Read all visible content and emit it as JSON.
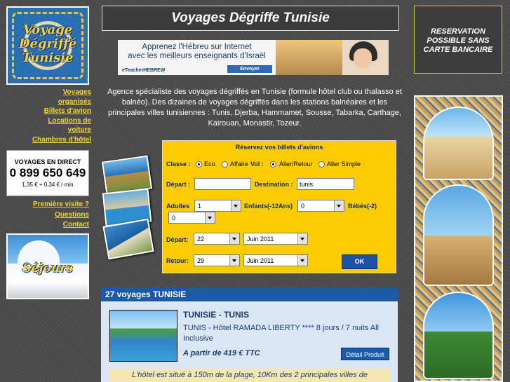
{
  "header": {
    "title": "Voyages Dégriffe Tunisie"
  },
  "logo": {
    "line1": "Voyage",
    "line2": "Dégriffé",
    "line3": "Tunisie"
  },
  "reservation": {
    "text": "RESERVATION POSSIBLE SANS CARTE BANCAIRE"
  },
  "ad": {
    "line1": "Apprenez l'Hébreu sur Internet",
    "line2": "avec les meilleurs enseignants d'Israël",
    "brand": "eTeacherHEBREW",
    "button": "Envoyer"
  },
  "sidebar": {
    "links1": [
      "Voyages organisés",
      "Billets d'avion",
      "Locations de voiture",
      "Chambres d'hôtel"
    ],
    "phone": {
      "label": "VOYAGES EN DIRECT",
      "number": "0 899 650 649",
      "price": "1,35 € + 0,34 € / min"
    },
    "links2": [
      "Première visite ?",
      "Questions",
      "Contact"
    ],
    "sejours": "Séjours"
  },
  "intro": "Agence spécialiste des voyages dégriffés en Tunisie (formule hôtel club ou thalasso et balnéo). Des dizaines de voyages dégriffés dans les stations balnéaires et les principales villes tunisiennes : Tunis, Djerba, Hammamet, Sousse, Tabarka, Carthage, Kairouan, Monastir, Tozeur.",
  "form": {
    "title": "Réservez vos billets d'avions",
    "classe_label": "Classe :",
    "classe_options": [
      "Eco.",
      "Affaire"
    ],
    "vol_label": "Vol :",
    "vol_options": [
      "Aller/Retour",
      "Aller Simple"
    ],
    "depart_label": "Départ :",
    "depart_value": "",
    "destination_label": "Destination :",
    "destination_value": "tunis",
    "adultes_label": "Adultes",
    "adultes_value": "1",
    "enfants_label": "Enfants(-12Ans)",
    "enfants_value": "0",
    "bebes_label": "Bébés(-2)",
    "bebes_value": "0",
    "date_depart_label": "Départ:",
    "date_depart_day": "22",
    "date_depart_month": "Juin 2011",
    "retour_label": "Retour:",
    "retour_day": "29",
    "retour_month": "Juin 2011",
    "ok": "OK"
  },
  "results": {
    "header": "27 voyages TUNISIE",
    "item": {
      "title": "TUNISIE - TUNIS",
      "desc": "TUNIS - Hôtel RAMADA LIBERTY **** 8 jours / 7 nuits All Inclusive",
      "price": "A partir de 419 € TTC",
      "button": "Détail Produit",
      "summary": "L'hôtel est situé à 150m de la plage, 10Km des 2 principales villes de"
    }
  }
}
